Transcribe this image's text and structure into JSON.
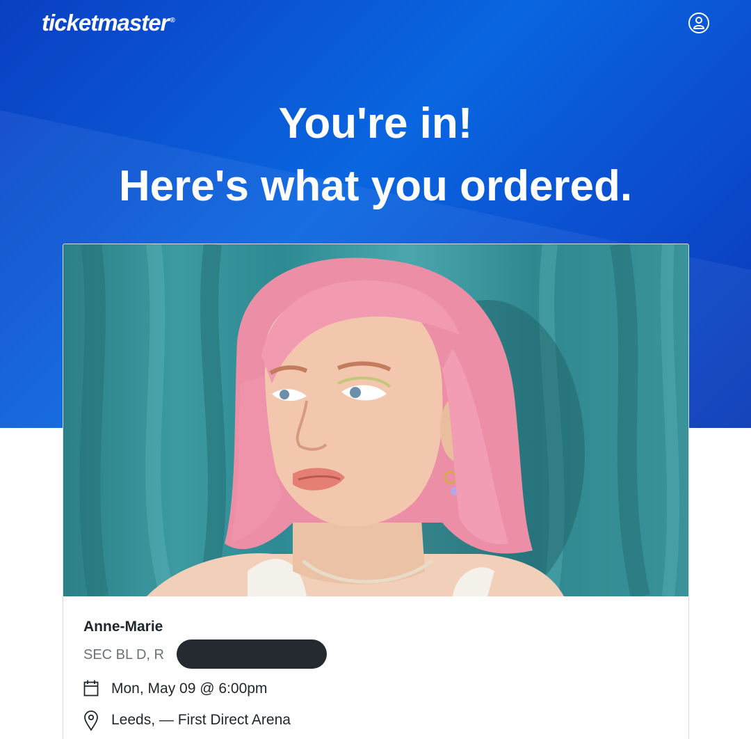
{
  "header": {
    "logo_text": "ticketmaster",
    "logo_mark": "®",
    "account_icon": "user-circle-icon"
  },
  "hero": {
    "headline_line1": "You're in!",
    "headline_line2": "Here's what you ordered."
  },
  "order": {
    "event_name": "Anne-Marie",
    "seat_text": "SEC BL D, R",
    "date_icon": "calendar-icon",
    "date_text": "Mon, May 09 @ 6:00pm",
    "venue_icon": "map-pin-icon",
    "venue_text": "Leeds, — First Direct Arena"
  },
  "colors": {
    "brand_blue": "#0a66e0",
    "text_dark": "#1f262d",
    "text_muted": "#6b7178"
  }
}
